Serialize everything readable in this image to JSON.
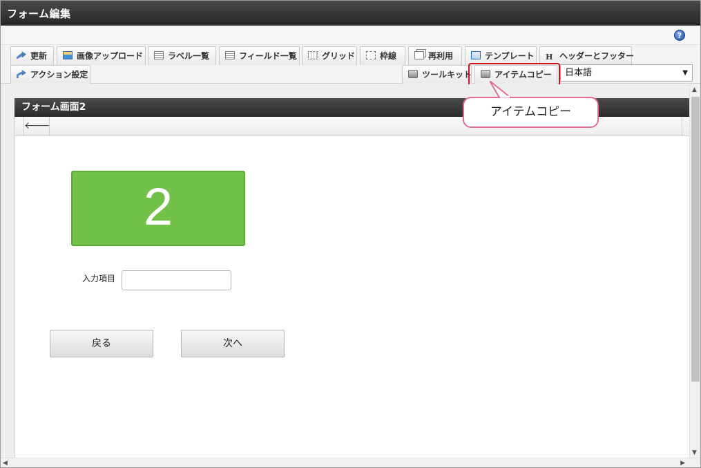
{
  "window": {
    "title": "フォーム編集"
  },
  "help": {
    "icon_text": "?"
  },
  "toolbar": {
    "row1": [
      {
        "id": "update",
        "label": "更新",
        "icon": "update-icon"
      },
      {
        "id": "image-upload",
        "label": "画像アップロード",
        "icon": "image-icon"
      },
      {
        "id": "label-list",
        "label": "ラベル一覧",
        "icon": "list-icon"
      },
      {
        "id": "field-list",
        "label": "フィールド一覧",
        "icon": "list-icon"
      },
      {
        "id": "grid",
        "label": "グリッド",
        "icon": "grid-icon"
      },
      {
        "id": "frame",
        "label": "枠線",
        "icon": "frame-icon"
      },
      {
        "id": "reuse",
        "label": "再利用",
        "icon": "reuse-icon"
      },
      {
        "id": "template",
        "label": "テンプレート",
        "icon": "template-icon"
      },
      {
        "id": "header-footer",
        "label": "ヘッダーとフッター",
        "icon": "header-icon",
        "icon_text": "H"
      }
    ],
    "row2": [
      {
        "id": "action-settings",
        "label": "アクション設定",
        "icon": "action-icon"
      },
      {
        "id": "toolkit",
        "label": "ツールキット",
        "icon": "toolbox-icon"
      },
      {
        "id": "item-copy",
        "label": "アイテムコピー",
        "icon": "toolbox-icon"
      }
    ],
    "language": {
      "selected": "日本語",
      "arrow": "▼"
    }
  },
  "callout": {
    "text": "アイテムコピー"
  },
  "panel": {
    "title": "フォーム画面2",
    "back_icon": "🡐",
    "step_number": "2",
    "field_label": "入力項目",
    "field_value": "",
    "back_button": "戻る",
    "next_button": "次へ"
  },
  "scroll": {
    "up": "▲",
    "down": "▼",
    "left": "◀",
    "right": "▶"
  },
  "colors": {
    "step_box": "#72c24a",
    "highlight": "#d0121b",
    "callout_border": "#e06b9a"
  }
}
